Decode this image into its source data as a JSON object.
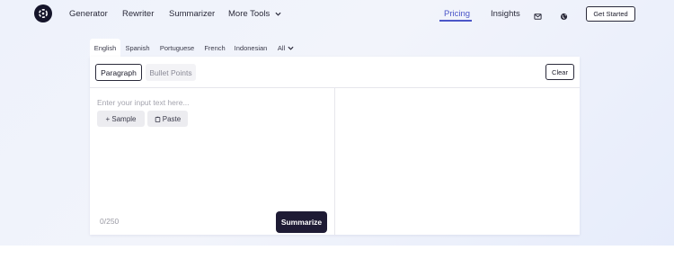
{
  "nav": {
    "links": [
      "Generator",
      "Rewriter",
      "Summarizer",
      "More Tools"
    ],
    "pricing": "Pricing",
    "insights": "Insights",
    "get_started": "Get Started",
    "icons": [
      "mail-icon",
      "globe-icon",
      "chevron-down-icon"
    ]
  },
  "languages": {
    "tabs": [
      "English",
      "Spanish",
      "Portuguese",
      "French",
      "Indonesian",
      "All"
    ],
    "selected": "English"
  },
  "editor": {
    "modes": [
      "Paragraph",
      "Bullet Points"
    ],
    "selected_mode": "Paragraph",
    "clear_label": "Clear",
    "placeholder": "Enter your input text here...",
    "sample_label": "+ Sample",
    "paste_label": "Paste",
    "counter": "0/250",
    "summarize_label": "Summarize"
  },
  "colors": {
    "accent": "#4b56c8",
    "primary_button": "#1e1b34"
  }
}
